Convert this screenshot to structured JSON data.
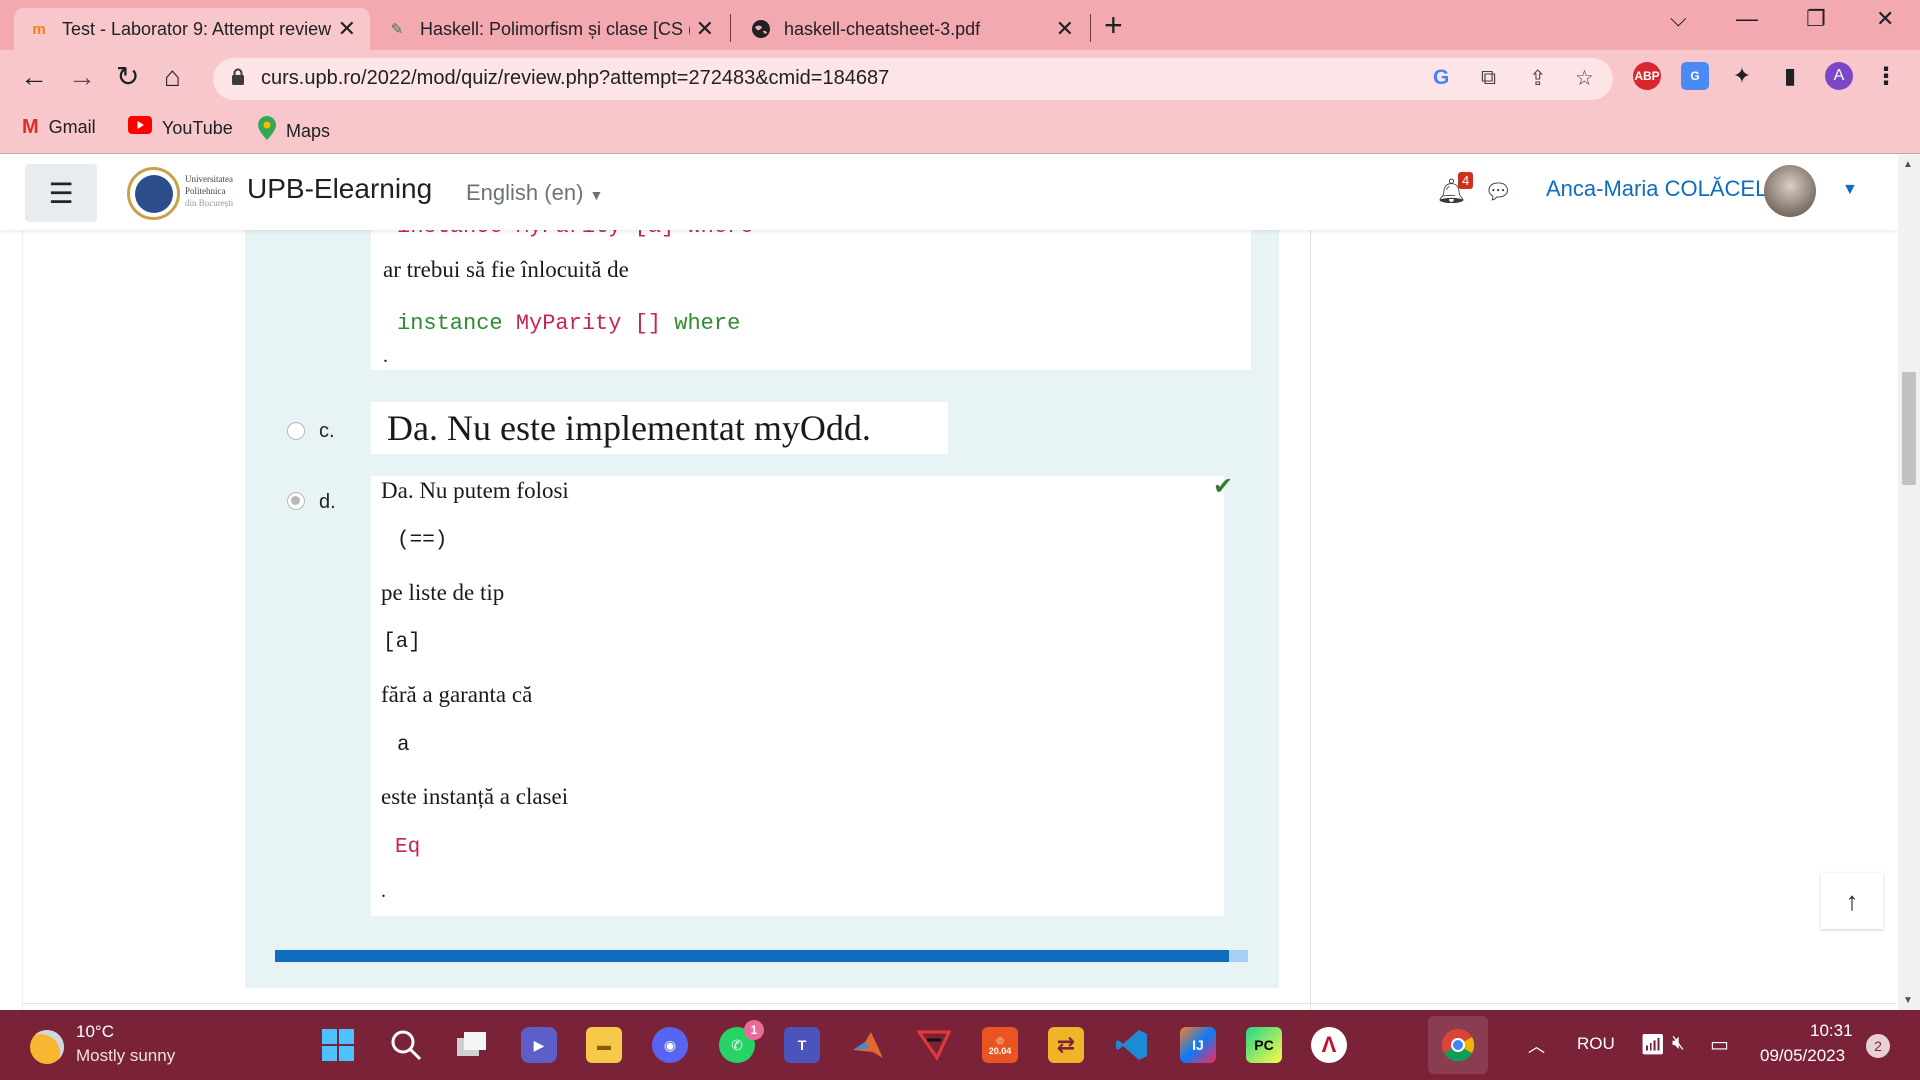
{
  "browser": {
    "tabs": [
      {
        "title": "Test - Laborator 9: Attempt review",
        "icon": "moodle-icon"
      },
      {
        "title": "Haskell: Polimorfism și clase [CS (",
        "icon": "dokuwiki-icon"
      },
      {
        "title": "haskell-cheatsheet-3.pdf",
        "icon": "globe-icon"
      }
    ],
    "url": "curs.upb.ro/2022/mod/quiz/review.php?attempt=272483&cmid=184687",
    "extensions": [
      "ABP",
      "A"
    ],
    "bookmarks": [
      {
        "label": "Gmail",
        "icon": "gmail-icon"
      },
      {
        "label": "YouTube",
        "icon": "youtube-icon"
      },
      {
        "label": "Maps",
        "icon": "maps-icon"
      }
    ]
  },
  "site": {
    "logo_lines": [
      "Universitatea",
      "Politehnica",
      "din București"
    ],
    "name": "UPB-Elearning",
    "language": "English (en)",
    "notification_count": "4",
    "user_name": "Anca-Maria COLĂCEL"
  },
  "question": {
    "option_b": {
      "text_top_partial": "instance MyParity [a] where",
      "text_replace": "ar trebui să fie înlocuită de",
      "code_keyword": "instance",
      "code_class": "MyParity",
      "code_list": "[]",
      "code_where": "where",
      "dot": "."
    },
    "option_c": {
      "letter": "c.",
      "text": "Da. Nu este implementat myOdd."
    },
    "option_d": {
      "letter": "d.",
      "line1": "Da. Nu putem folosi",
      "code1": "(==)",
      "line2": "pe liste de tip",
      "code2": "[a]",
      "line3": "fără a garanta că",
      "code3": "a",
      "line4": "este instanță a clasei",
      "code4": "Eq",
      "dot": ".",
      "selected": true,
      "correct": true
    },
    "progress_fraction": 0.98
  },
  "taskbar": {
    "weather_temp": "10°C",
    "weather_desc": "Mostly sunny",
    "whatsapp_badge": "1",
    "ubuntu_label": "20.04",
    "language": "ROU",
    "time": "10:31",
    "date": "09/05/2023",
    "notification_count": "2"
  },
  "colors": {
    "tab_bar": "#f3a9b0",
    "toolbar": "#f8c7cc",
    "taskbar": "#7a2338",
    "moodle_blue": "#0f6cbf",
    "correct_green": "#357a32",
    "question_bg": "#e7f3f5"
  }
}
